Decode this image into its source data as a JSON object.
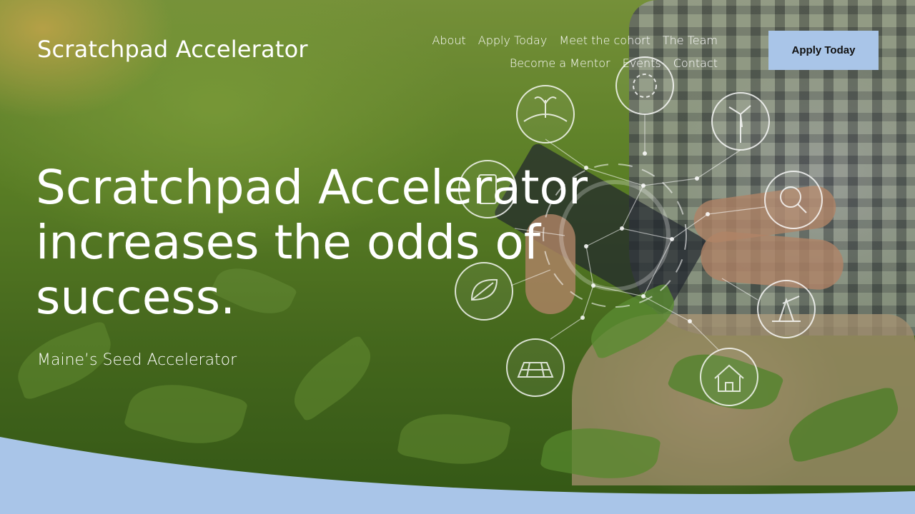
{
  "header": {
    "logo_text": "Scratchpad Accelerator",
    "nav_row_1": [
      {
        "label": "About"
      },
      {
        "label": "Apply Today"
      },
      {
        "label": "Meet the cohort"
      },
      {
        "label": "The Team"
      }
    ],
    "nav_row_2": [
      {
        "label": "Become a Mentor"
      },
      {
        "label": "Events"
      },
      {
        "label": "Contact"
      }
    ],
    "cta_label": "Apply Today"
  },
  "hero": {
    "headline": "Scratchpad Accelerator increases the odds of success.",
    "subheadline": "Maine’s Seed Accelerator",
    "background_image": "farmer-with-tablet-in-crop-field",
    "tech_icons": [
      "sprout-icon",
      "gear-icon",
      "wind-turbine-icon",
      "search-icon",
      "leaf-icon",
      "oil-pump-icon",
      "solar-panel-icon",
      "home-icon",
      "phone-icon"
    ]
  },
  "colors": {
    "accent": "#a9c5e8",
    "text_on_image": "#ffffff",
    "button_text": "#111111"
  }
}
